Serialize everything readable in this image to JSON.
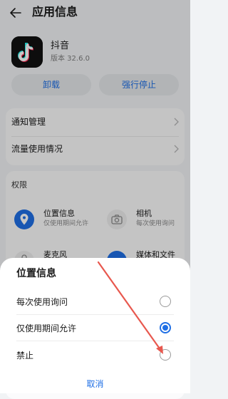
{
  "header": {
    "title": "应用信息",
    "back_icon": "arrow-left-icon"
  },
  "app": {
    "name": "抖音",
    "version": "版本 32.6.0",
    "icon": "tiktok-logo"
  },
  "actions": {
    "uninstall": "卸载",
    "force_stop": "强行停止",
    "accent": "#1f6fe5"
  },
  "settings": [
    {
      "label": "通知管理"
    },
    {
      "label": "流量使用情况"
    }
  ],
  "permissions": {
    "title": "权限",
    "items": [
      {
        "name": "位置信息",
        "status": "仅使用期间允许",
        "icon": "location-icon"
      },
      {
        "name": "相机",
        "status": "每次使用询问",
        "icon": "camera-icon"
      },
      {
        "name": "麦克风",
        "status": "",
        "icon": "microphone-icon"
      },
      {
        "name": "媒体和文件",
        "status": "",
        "icon": "folder-icon"
      }
    ]
  },
  "sheet": {
    "title": "位置信息",
    "options": [
      {
        "label": "每次使用询问",
        "selected": false
      },
      {
        "label": "仅使用期间允许",
        "selected": true
      },
      {
        "label": "禁止",
        "selected": false
      }
    ],
    "cancel": "取消"
  },
  "annotation": {
    "color": "#e8584e"
  }
}
